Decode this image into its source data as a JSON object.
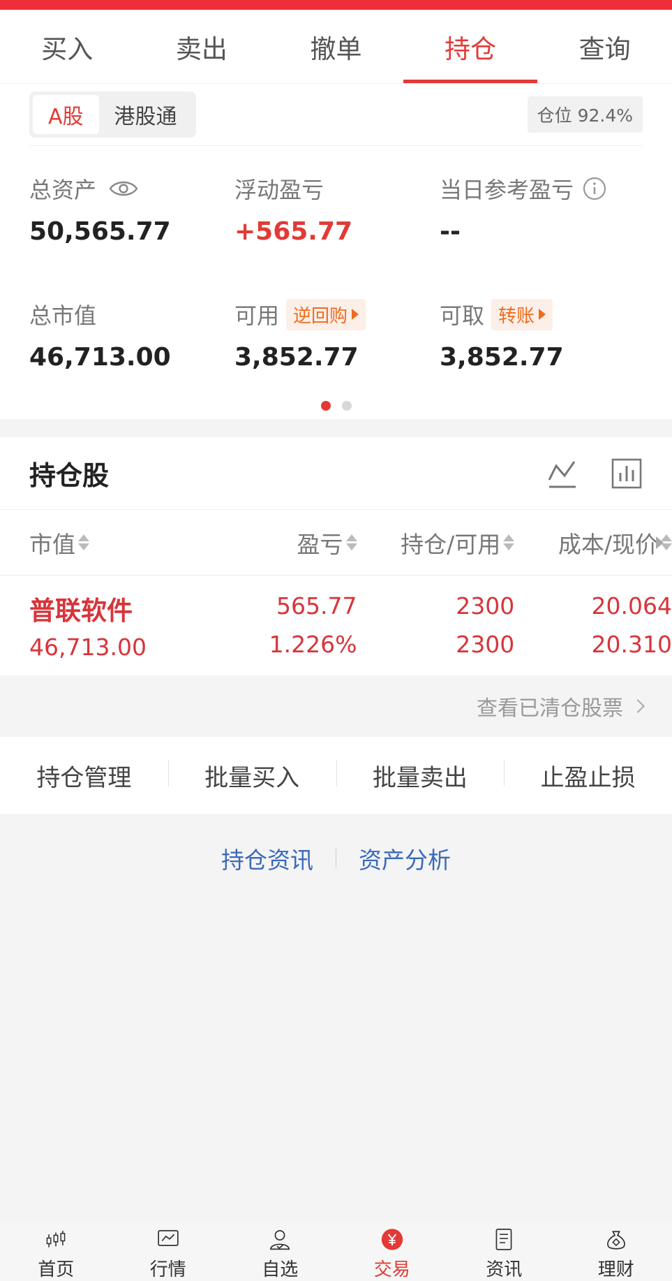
{
  "tabs": [
    {
      "label": "买入"
    },
    {
      "label": "卖出"
    },
    {
      "label": "撤单"
    },
    {
      "label": "持仓",
      "active": true
    },
    {
      "label": "查询"
    }
  ],
  "market": {
    "segments": [
      "A股",
      "港股通"
    ],
    "active": "A股",
    "position_badge": "仓位 92.4%"
  },
  "stats": {
    "total_assets": {
      "label": "总资产",
      "value": "50,565.77"
    },
    "floating_pl": {
      "label": "浮动盈亏",
      "value": "+565.77"
    },
    "daily_ref_pl": {
      "label": "当日参考盈亏",
      "value": "--"
    },
    "market_value": {
      "label": "总市值",
      "value": "46,713.00"
    },
    "available": {
      "label": "可用",
      "tag": "逆回购",
      "value": "3,852.77"
    },
    "withdrawable": {
      "label": "可取",
      "tag": "转账",
      "value": "3,852.77"
    }
  },
  "holdings": {
    "title": "持仓股",
    "columns": [
      "市值",
      "盈亏",
      "持仓/可用",
      "成本/现价"
    ],
    "rows": [
      {
        "name": "普联软件",
        "market_value": "46,713.00",
        "pl": "565.77",
        "pl_pct": "1.226%",
        "position": "2300",
        "available": "2300",
        "cost": "20.064",
        "price": "20.310"
      }
    ],
    "cleared_link": "查看已清仓股票"
  },
  "actions": [
    "持仓管理",
    "批量买入",
    "批量卖出",
    "止盈止损"
  ],
  "links": [
    "持仓资讯",
    "资产分析"
  ],
  "bottom_nav": [
    {
      "label": "首页",
      "icon": "candlestick-icon"
    },
    {
      "label": "行情",
      "icon": "market-chart-icon"
    },
    {
      "label": "自选",
      "icon": "user-check-icon"
    },
    {
      "label": "交易",
      "icon": "yuan-icon",
      "active": true
    },
    {
      "label": "资讯",
      "icon": "document-icon"
    },
    {
      "label": "理财",
      "icon": "money-bag-icon"
    }
  ],
  "colors": {
    "accent": "#e23a36",
    "tag": "#f06b1e",
    "link": "#3a6ab8"
  }
}
